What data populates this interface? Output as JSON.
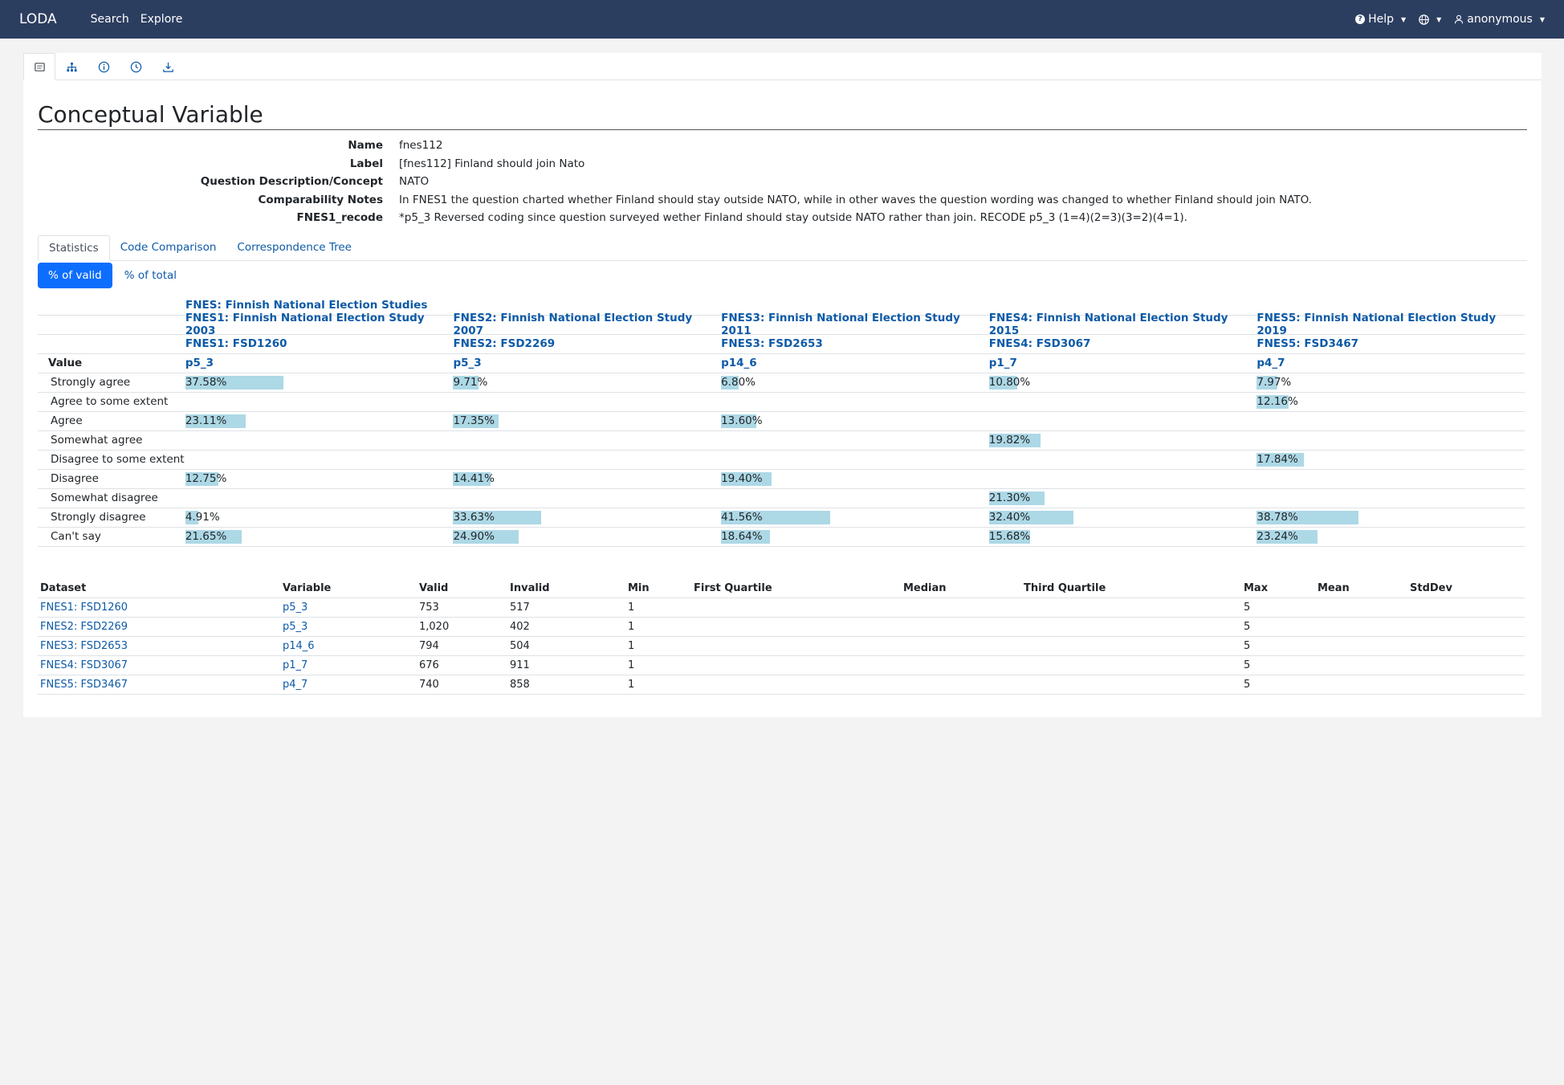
{
  "navbar": {
    "brand": "LODA",
    "links": [
      "Search",
      "Explore"
    ],
    "help_label": "Help",
    "user_label": "anonymous"
  },
  "page": {
    "title": "Conceptual Variable",
    "properties": [
      {
        "key": "Name",
        "value": "fnes112"
      },
      {
        "key": "Label",
        "value": "[fnes112] Finland should join Nato"
      },
      {
        "key": "Question Description/Concept",
        "value": "NATO"
      },
      {
        "key": "Comparability Notes",
        "value": "In FNES1 the question charted whether Finland should stay outside NATO, while in other waves the question wording was changed to whether Finland should join NATO."
      },
      {
        "key": "FNES1_recode",
        "value": "*p5_3 Reversed coding since question surveyed wether Finland should stay outside NATO rather than join. RECODE p5_3 (1=4)(2=3)(3=2)(4=1)."
      }
    ],
    "tabs": [
      "Statistics",
      "Code Comparison",
      "Correspondence Tree"
    ],
    "pills": [
      "% of valid",
      "% of total"
    ]
  },
  "stats": {
    "series_title": "FNES: Finnish National Election Studies",
    "value_header": "Value",
    "studies": [
      {
        "study": "FNES1: Finnish National Election Study 2003",
        "dataset": "FNES1: FSD1260",
        "variable": "p5_3"
      },
      {
        "study": "FNES2: Finnish National Election Study 2007",
        "dataset": "FNES2: FSD2269",
        "variable": "p5_3"
      },
      {
        "study": "FNES3: Finnish National Election Study 2011",
        "dataset": "FNES3: FSD2653",
        "variable": "p14_6"
      },
      {
        "study": "FNES4: Finnish National Election Study 2015",
        "dataset": "FNES4: FSD3067",
        "variable": "p1_7"
      },
      {
        "study": "FNES5: Finnish National Election Study 2019",
        "dataset": "FNES5: FSD3467",
        "variable": "p4_7"
      }
    ],
    "rows": [
      {
        "label": "Strongly agree",
        "values": [
          "37.58%",
          "9.71%",
          "6.80%",
          "10.80%",
          "7.97%"
        ]
      },
      {
        "label": "Agree to some extent",
        "values": [
          "",
          "",
          "",
          "",
          "12.16%"
        ]
      },
      {
        "label": "Agree",
        "values": [
          "23.11%",
          "17.35%",
          "13.60%",
          "",
          ""
        ]
      },
      {
        "label": "Somewhat agree",
        "values": [
          "",
          "",
          "",
          "19.82%",
          ""
        ]
      },
      {
        "label": "Disagree to some extent",
        "values": [
          "",
          "",
          "",
          "",
          "17.84%"
        ]
      },
      {
        "label": "Disagree",
        "values": [
          "12.75%",
          "14.41%",
          "19.40%",
          "",
          ""
        ]
      },
      {
        "label": "Somewhat disagree",
        "values": [
          "",
          "",
          "",
          "21.30%",
          ""
        ]
      },
      {
        "label": "Strongly disagree",
        "values": [
          "4.91%",
          "33.63%",
          "41.56%",
          "32.40%",
          "38.78%"
        ]
      },
      {
        "label": "Can't say",
        "values": [
          "21.65%",
          "24.90%",
          "18.64%",
          "15.68%",
          "23.24%"
        ]
      }
    ]
  },
  "summary": {
    "headers": [
      "Dataset",
      "Variable",
      "Valid",
      "Invalid",
      "Min",
      "First Quartile",
      "Median",
      "Third Quartile",
      "Max",
      "Mean",
      "StdDev"
    ],
    "rows": [
      [
        "FNES1: FSD1260",
        "p5_3",
        "753",
        "517",
        "1",
        "",
        "",
        "",
        "5",
        "",
        ""
      ],
      [
        "FNES2: FSD2269",
        "p5_3",
        "1,020",
        "402",
        "1",
        "",
        "",
        "",
        "5",
        "",
        ""
      ],
      [
        "FNES3: FSD2653",
        "p14_6",
        "794",
        "504",
        "1",
        "",
        "",
        "",
        "5",
        "",
        ""
      ],
      [
        "FNES4: FSD3067",
        "p1_7",
        "676",
        "911",
        "1",
        "",
        "",
        "",
        "5",
        "",
        ""
      ],
      [
        "FNES5: FSD3467",
        "p4_7",
        "740",
        "858",
        "1",
        "",
        "",
        "",
        "5",
        "",
        ""
      ]
    ]
  },
  "colors": {
    "navbar": "#2c3e60",
    "bar": "#add8e6",
    "link": "#0d5aa7",
    "active_pill": "#0d6efd"
  }
}
